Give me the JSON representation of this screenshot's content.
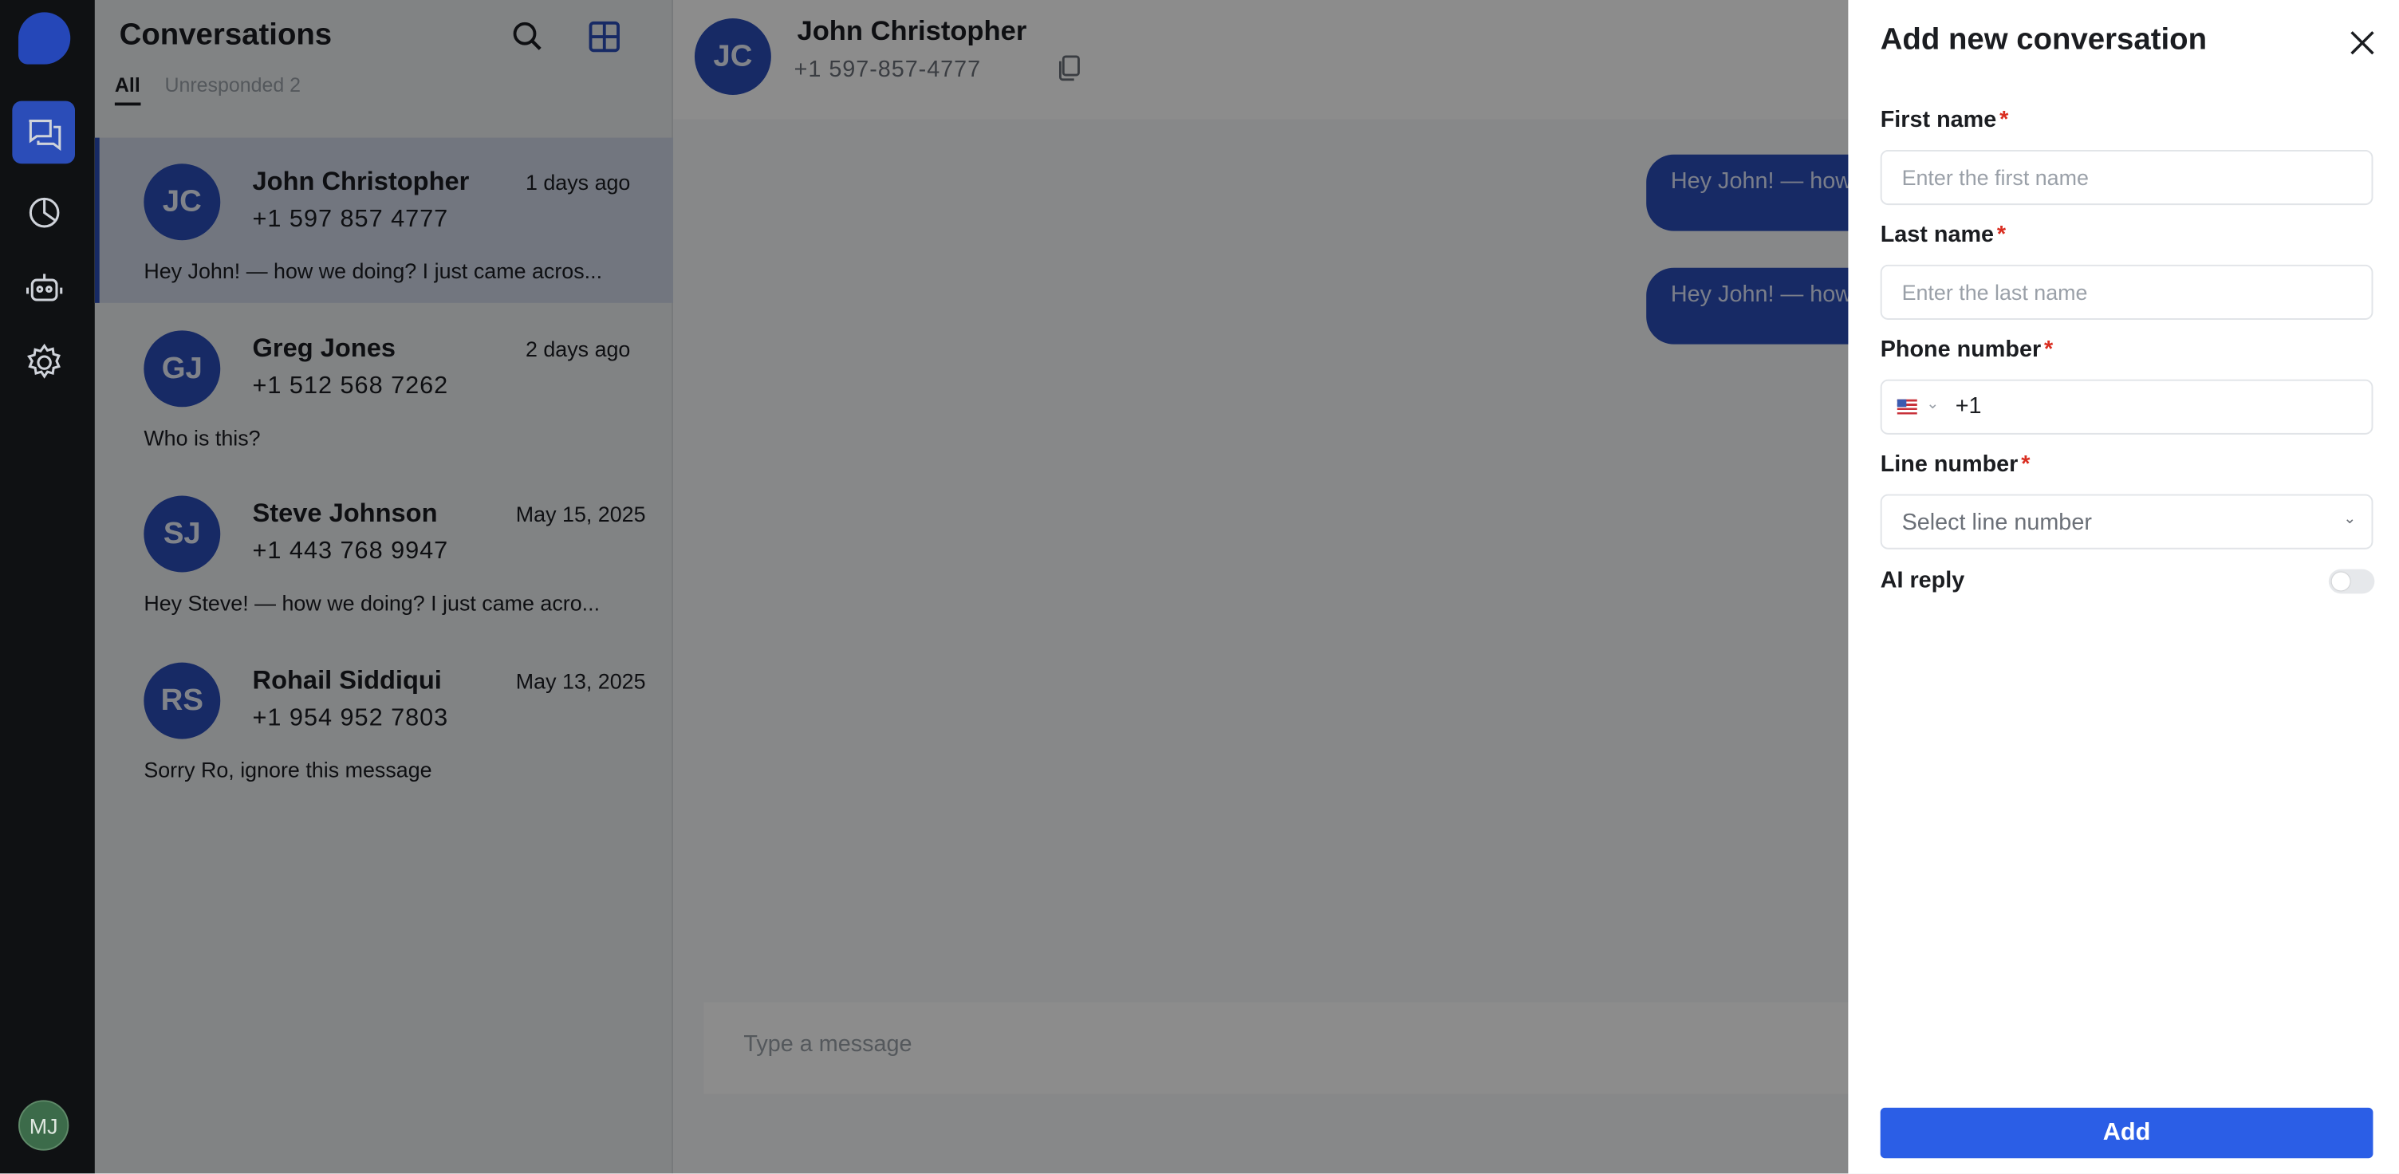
{
  "rail": {
    "logo": "app-logo",
    "items": [
      {
        "icon": "chat-icon",
        "active": true
      },
      {
        "icon": "analytics-icon",
        "active": false
      },
      {
        "icon": "robot-icon",
        "active": false
      },
      {
        "icon": "gear-icon",
        "active": false
      }
    ],
    "avatar": "MJ"
  },
  "list": {
    "title": "Conversations",
    "tabs": [
      {
        "label": "All",
        "active": true
      },
      {
        "label": "Unresponded 2",
        "active": false
      }
    ],
    "conversations": [
      {
        "initials": "JC",
        "name": "John Christopher",
        "phone": "+1 597 857 4777",
        "time": "1 days ago",
        "preview": "Hey John! — how we doing? I just came acros...",
        "selected": true
      },
      {
        "initials": "GJ",
        "name": "Greg Jones",
        "phone": "+1 512 568 7262",
        "time": "2 days ago",
        "preview": "Who is this?",
        "selected": false
      },
      {
        "initials": "SJ",
        "name": "Steve Johnson",
        "phone": "+1 443 768 9947",
        "time": "May 15, 2025",
        "preview": "Hey Steve! — how we doing? I just came acro...",
        "selected": false
      },
      {
        "initials": "RS",
        "name": "Rohail Siddiqui",
        "phone": "+1 954 952 7803",
        "time": "May 13, 2025",
        "preview": "Sorry Ro, ignore this message",
        "selected": false
      }
    ]
  },
  "chat": {
    "initials": "JC",
    "name": "John Christopher",
    "phone": "+1 597-857-4777",
    "messages": [
      {
        "text": "Hey John! — how"
      },
      {
        "text": "Hey John! — how"
      }
    ],
    "composer_placeholder": "Type a message"
  },
  "drawer": {
    "title": "Add new conversation",
    "first_name": {
      "label": "First name",
      "required": "*",
      "placeholder": "Enter the first name"
    },
    "last_name": {
      "label": "Last name",
      "required": "*",
      "placeholder": "Enter the last name"
    },
    "phone": {
      "label": "Phone number",
      "required": "*",
      "country_code": "+1"
    },
    "line": {
      "label": "Line number",
      "required": "*",
      "placeholder": "Select line number"
    },
    "ai_reply": {
      "label": "AI reply",
      "enabled": false
    },
    "add_label": "Add"
  },
  "colors": {
    "accent": "#2b4db8",
    "add_button": "#2b5ee6",
    "required": "#d92d20"
  }
}
